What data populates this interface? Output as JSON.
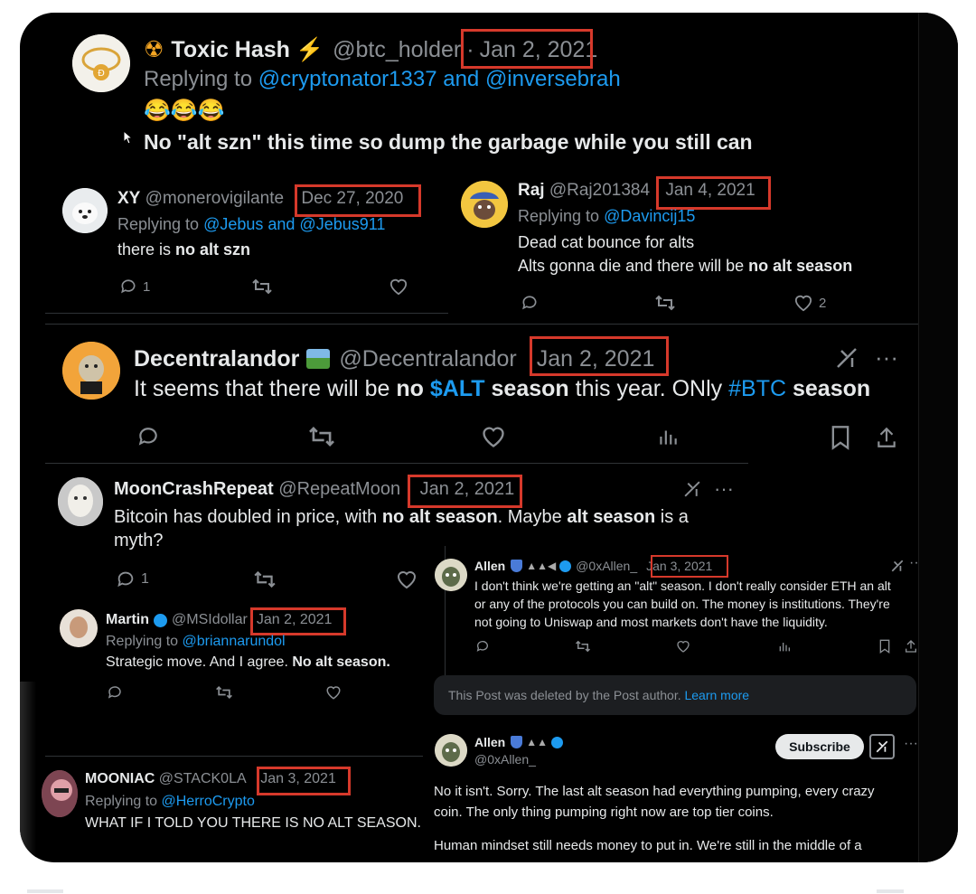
{
  "t1": {
    "name": "Toxic Hash",
    "name_prefix": "☢",
    "name_suffix": "⚡",
    "handle": "@btc_holder",
    "sep": "·",
    "date": "Jan 2, 2021",
    "reply_prefix": "Replying to",
    "reply_to": "@cryptonator1337 and @inversebrah",
    "emoji": "😂😂😂",
    "text_a": "No \"",
    "text_b": "alt szn",
    "text_c": "\" this time so dump the garbage while you still can"
  },
  "xy": {
    "name": "XY",
    "handle": "@monerovigilante",
    "date": "Dec 27, 2020",
    "reply_prefix": "Replying to",
    "reply_to": "@Jebus and @Jebus911",
    "text_a": "there is ",
    "text_b": "no alt szn",
    "reply_count": "1"
  },
  "raj": {
    "name": "Raj",
    "handle": "@Raj201384",
    "date": "Jan 4, 2021",
    "reply_prefix": "Replying to",
    "reply_to": "@Davincij15",
    "line1": "Dead cat bounce for alts",
    "line2_a": "Alts gonna die and there will be ",
    "line2_b": "no alt season",
    "like_count": "2"
  },
  "dec": {
    "name": "Decentralandor",
    "handle": "@Decentralandor",
    "date": "Jan 2, 2021",
    "text_a": "It seems that there will be ",
    "text_b": "no ",
    "text_c": "$ALT",
    "text_d": " season",
    "text_e": " this year. ONly ",
    "text_f": "#BTC",
    "text_g": " season"
  },
  "moon": {
    "name": "MoonCrashRepeat",
    "handle": "@RepeatMoon",
    "date": "Jan 2, 2021",
    "text_a": "Bitcoin has doubled in price, with ",
    "text_b": "no alt season",
    "text_c": ". Maybe ",
    "text_d": "alt season",
    "text_e": " is a",
    "text_f": "myth?",
    "reply_count": "1"
  },
  "allen1": {
    "name": "Allen",
    "handle": "@0xAllen_",
    "date": "Jan 3, 2021",
    "line1": "I don't think we're getting an \"alt\" season. I don't really consider ETH an alt",
    "line2": "or any of the protocols you can build on. The money is institutions. They're",
    "line3": "not going to Uniswap and most markets don't have the liquidity."
  },
  "martin": {
    "name": "Martin",
    "handle": "@MSIdollar",
    "date": "Jan 2, 2021",
    "reply_prefix": "Replying to",
    "reply_to": "@briannarundol",
    "text_a": "Strategic move. And I agree. ",
    "text_b": "No alt season."
  },
  "deleted": {
    "text": "This Post was deleted by the Post author.",
    "link": "Learn more"
  },
  "allen2": {
    "name": "Allen",
    "handle": "@0xAllen_",
    "subscribe": "Subscribe",
    "line1": "No it isn't. Sorry. The last alt season had everything pumping, every crazy",
    "line2": "coin. The only thing pumping right now are top tier coins.",
    "line3": "Human mindset still needs money to put in. We're still in the middle of a"
  },
  "mooniac": {
    "name": "MOONIAC",
    "handle": "@STACK0LA",
    "date": "Jan 3, 2021",
    "reply_prefix": "Replying to",
    "reply_to": "@HerroCrypto",
    "text": "WHAT IF I TOLD YOU THERE IS NO ALT SEASON."
  },
  "colors": {
    "background": "#000000",
    "text": "#e7e9ea",
    "muted": "#8b8f94",
    "link": "#1d9bf0",
    "highlight": "#d6392b"
  }
}
